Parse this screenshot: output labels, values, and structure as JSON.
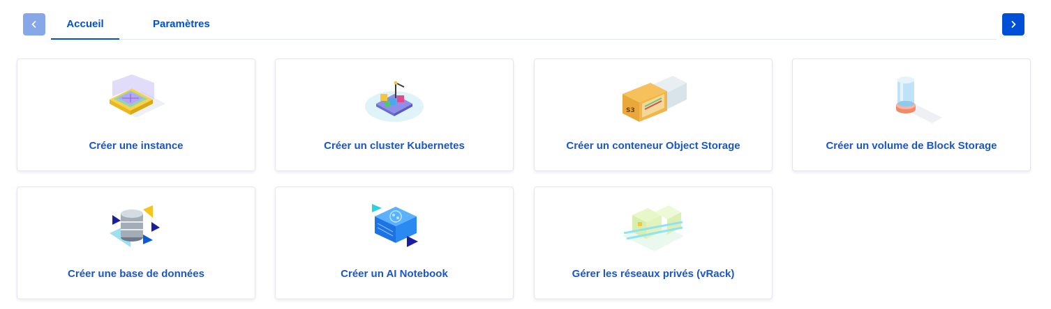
{
  "tabs": [
    {
      "label": "Accueil",
      "active": true
    },
    {
      "label": "Paramètres",
      "active": false
    }
  ],
  "navigation": {
    "prev_icon": "chevron-left-icon",
    "next_icon": "chevron-right-icon"
  },
  "cards": [
    {
      "label": "Créer une instance",
      "icon": "instance-icon"
    },
    {
      "label": "Créer un cluster Kubernetes",
      "icon": "kubernetes-icon"
    },
    {
      "label": "Créer un conteneur Object Storage",
      "icon": "object-storage-icon"
    },
    {
      "label": "Créer un volume de Block Storage",
      "icon": "block-storage-icon"
    },
    {
      "label": "Créer une base de données",
      "icon": "database-icon"
    },
    {
      "label": "Créer un AI Notebook",
      "icon": "ai-notebook-icon"
    },
    {
      "label": "Gérer les réseaux privés (vRack)",
      "icon": "vrack-network-icon"
    }
  ],
  "colors": {
    "accent": "#0050d7",
    "accent_light": "#86a7e8",
    "card_text": "#1a56c9",
    "card_border": "#e3e6f2"
  }
}
